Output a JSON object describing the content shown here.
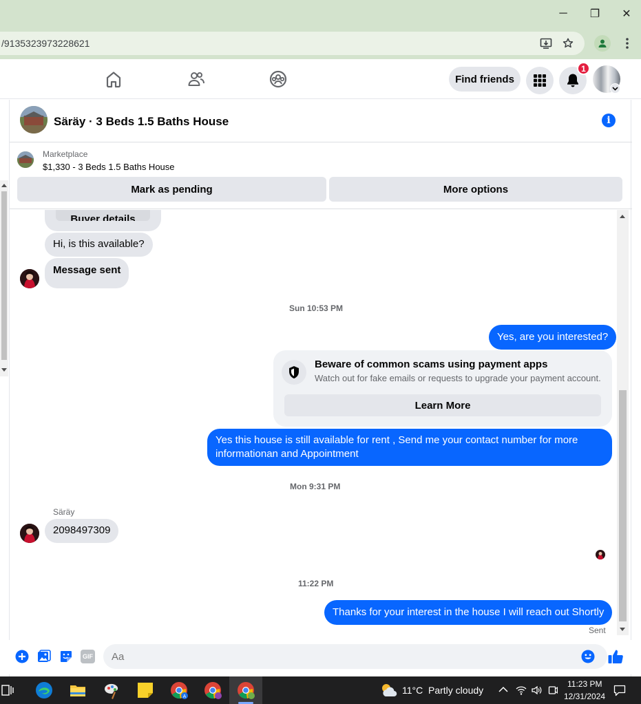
{
  "browser": {
    "url": "/9135323973228621",
    "window_buttons": {
      "minimize": "─",
      "restore": "❐",
      "close": "✕"
    }
  },
  "fbnav": {
    "find_friends_label": "Find friends",
    "notification_count": "1"
  },
  "chat": {
    "title": "Säräy · 3 Beds 1.5 Baths House",
    "info_glyph": "i",
    "listing": {
      "category": "Marketplace",
      "description": "$1,330 - 3 Beds 1.5 Baths House",
      "mark_pending_label": "Mark as pending",
      "more_options_label": "More options"
    },
    "partial_button": "Buyer details",
    "messages": {
      "msg1": "Hi, is this available?",
      "msg2": "Message sent",
      "stamp1": "Sun 10:53 PM",
      "out1": "Yes, are you interested?",
      "scam_title": "Beware of common scams using payment apps",
      "scam_text": "Watch out for fake emails or requests to upgrade your payment account.",
      "learn_more": "Learn More",
      "out2": "Yes this house is still available for rent , Send me your contact number for more informationan and Appointment",
      "stamp2": "Mon 9:31 PM",
      "sender_name": "Säräy",
      "msg3": "2098497309",
      "stamp3": "11:22 PM",
      "out3": "Thanks for your interest in the house I will reach out Shortly",
      "status": "Sent"
    },
    "composer": {
      "placeholder": "Aa",
      "gif_label": "GIF"
    }
  },
  "taskbar": {
    "weather_temp": "11°C",
    "weather_desc": "Partly cloudy",
    "time": "11:23 PM",
    "date": "12/31/2024"
  },
  "colors": {
    "accent": "#0866ff",
    "bubble_in": "#e4e6eb",
    "browser_frame": "#d3e3cd"
  }
}
